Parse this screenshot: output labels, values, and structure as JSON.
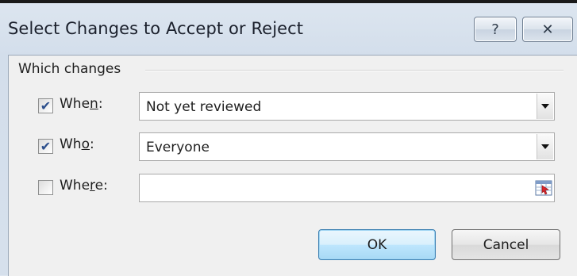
{
  "dialog": {
    "title": "Select Changes to Accept or Reject",
    "help_label": "?",
    "close_label": "✕",
    "group_label": "Which changes"
  },
  "rows": [
    {
      "checked": true,
      "label_pre": "Whe",
      "label_key": "n",
      "label_post": ":",
      "value": "Not yet reviewed",
      "control": "dropdown"
    },
    {
      "checked": true,
      "label_pre": "Wh",
      "label_key": "o",
      "label_post": ":",
      "value": "Everyone",
      "control": "dropdown"
    },
    {
      "checked": false,
      "label_pre": "Whe",
      "label_key": "r",
      "label_post": "e:",
      "value": "",
      "control": "range-picker"
    }
  ],
  "buttons": {
    "ok_label": "OK",
    "cancel_label": "Cancel"
  },
  "colors": {
    "check_mark": "#2c4f8c",
    "ok_border": "#3c7fb1"
  },
  "icons": {
    "help": "question-mark-icon",
    "close": "close-icon",
    "dropdown": "chevron-down-icon",
    "range": "collapse-dialog-icon"
  }
}
